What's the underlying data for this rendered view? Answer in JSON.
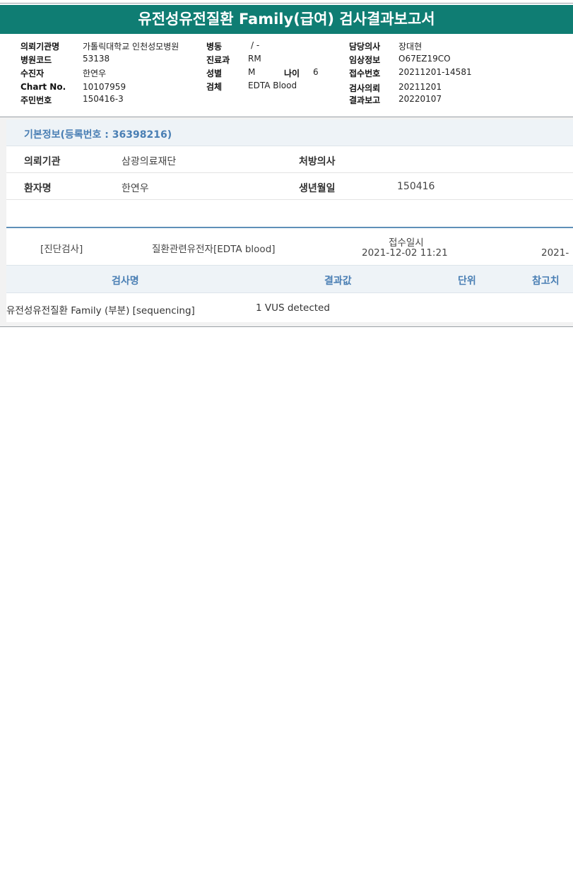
{
  "report_title": "유전성유전질환 Family(급여) 검사결과보고서",
  "header": {
    "hospital_label": "의뢰기관명",
    "hospital_value": "가톨릭대학교 인천성모병원",
    "hospital_code_label": "병원코드",
    "hospital_code_value": "53138",
    "patient_label": "수진자",
    "patient_value": "한연우",
    "chart_label": "Chart No.",
    "chart_value": "10107959",
    "resident_label": "주민번호",
    "resident_value": "150416-3",
    "ward_label": "병동",
    "ward_value": "/ -",
    "dept_label": "진료과",
    "dept_value": "RM",
    "sex_label": "성별",
    "sex_value": "M",
    "age_label": "나이",
    "age_value": "6",
    "specimen_label": "검체",
    "specimen_value": "EDTA Blood",
    "doctor_label": "담당의사",
    "doctor_value": "장대현",
    "clinical_label": "임상정보",
    "clinical_value": "O67EZ19CO",
    "receipt_no_label": "접수번호",
    "receipt_no_value": "20211201-14581",
    "request_label": "검사의뢰",
    "request_value": "20211201",
    "report_label": "결과보고",
    "report_value": "20220107"
  },
  "basic_info": {
    "heading": "기본정보(등록번호 : 36398216)",
    "institution_label": "의뢰기관",
    "institution_value": "삼광의료재단",
    "prescriber_label": "처방의사",
    "prescriber_value": "",
    "patient_label": "환자명",
    "patient_value": "한연우",
    "dob_label": "생년월일",
    "dob_value": "150416"
  },
  "order": {
    "category": "[진단검사]",
    "test_name": "질환관련유전자[EDTA blood]",
    "received_label": "접수일시",
    "received_value": "2021-12-02  11:21",
    "next_value": "2021-"
  },
  "results": {
    "columns": [
      "검사명",
      "결과값",
      "단위",
      "참고치"
    ],
    "rows": [
      {
        "name": "유전성유전질환 Family (부분) [sequencing]",
        "value": "1 VUS detected",
        "unit": "",
        "reference": ""
      }
    ]
  }
}
